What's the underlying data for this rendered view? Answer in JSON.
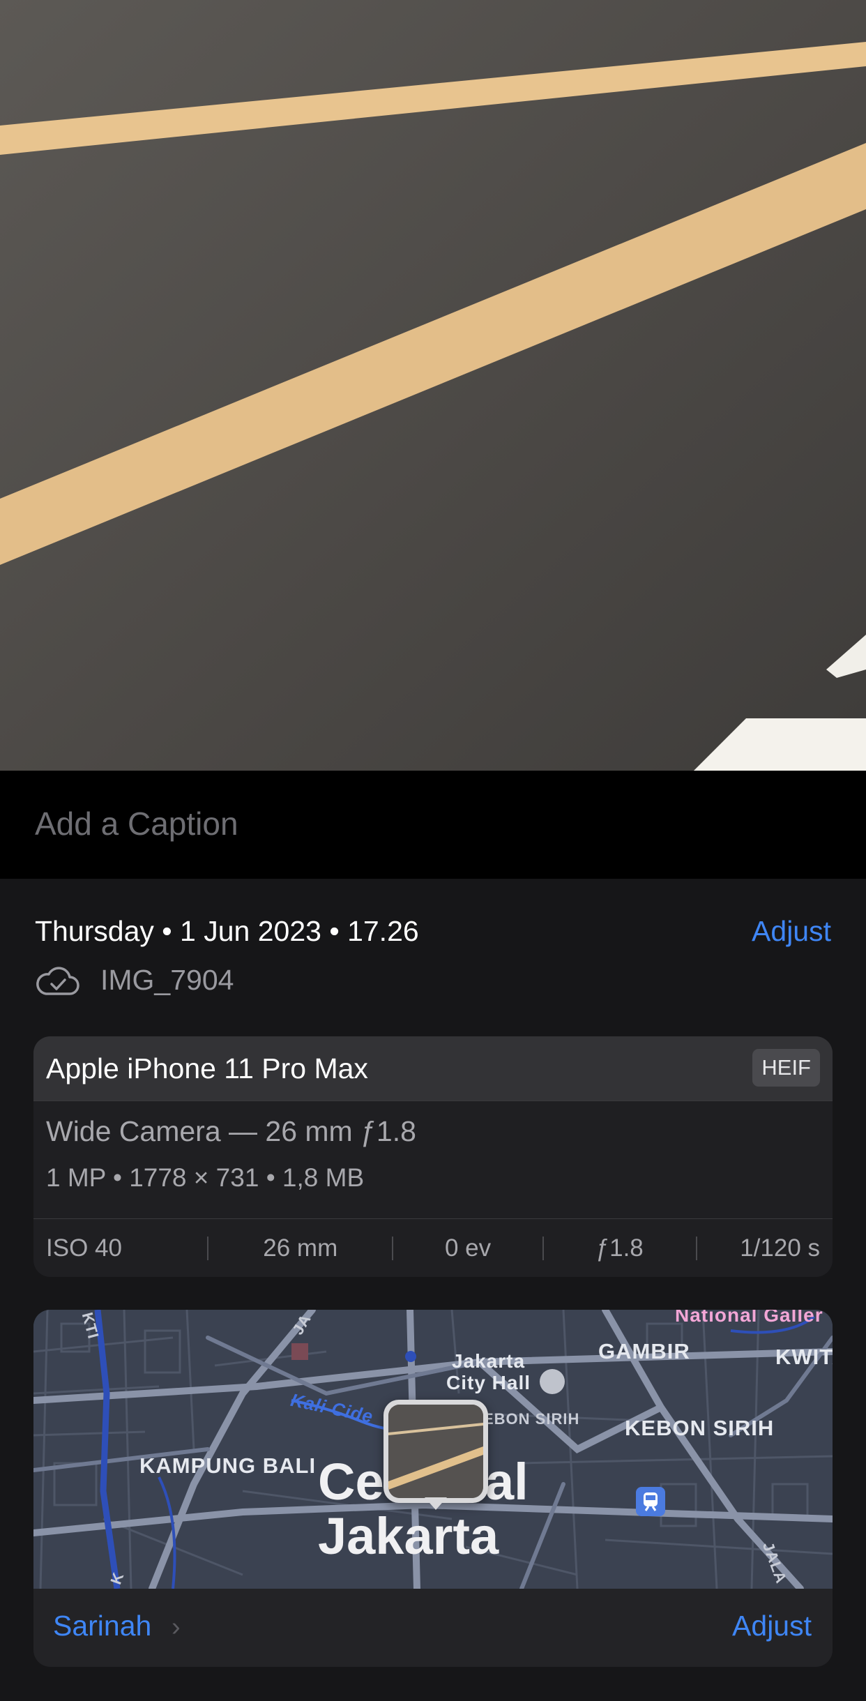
{
  "caption": {
    "placeholder": "Add a Caption"
  },
  "meta": {
    "datetime": "Thursday • 1 Jun 2023 • 17.26",
    "adjust_label": "Adjust",
    "filename": "IMG_7904",
    "cloud_icon": "cloud-check-icon"
  },
  "camera": {
    "device": "Apple iPhone 11 Pro Max",
    "format_badge": "HEIF",
    "lens": "Wide Camera — 26 mm ƒ1.8",
    "specs": "1 MP  •  1778 × 731  •  1,8 MB",
    "exif": {
      "iso": "ISO 40",
      "focal": "26 mm",
      "ev": "0 ev",
      "aperture": "ƒ1.8",
      "shutter": "1/120 s"
    }
  },
  "map": {
    "labels": {
      "national_gallery": "National Galler",
      "gambir": "GAMBIR",
      "kwitang": "KWITA",
      "city_hall": "Jakarta\nCity Hall",
      "kebon_sirih_small": "EBON SIRIH",
      "kebon_sirih": "KEBON SIRIH",
      "kampung_bali": "KAMPUNG BALI",
      "kali_cideng": "Kali Cide",
      "central": "Ce",
      "central_end": "al",
      "jakarta": "Jakarta",
      "street_ja": "JA",
      "street_kti": "KTI",
      "street_jala": "JALA",
      "street_k": "K"
    },
    "place_name": "Sarinah",
    "place_chevron": "›",
    "adjust_label": "Adjust"
  },
  "colors": {
    "accent": "#3f86f5",
    "background": "#161618",
    "card": "#1f1f22"
  }
}
